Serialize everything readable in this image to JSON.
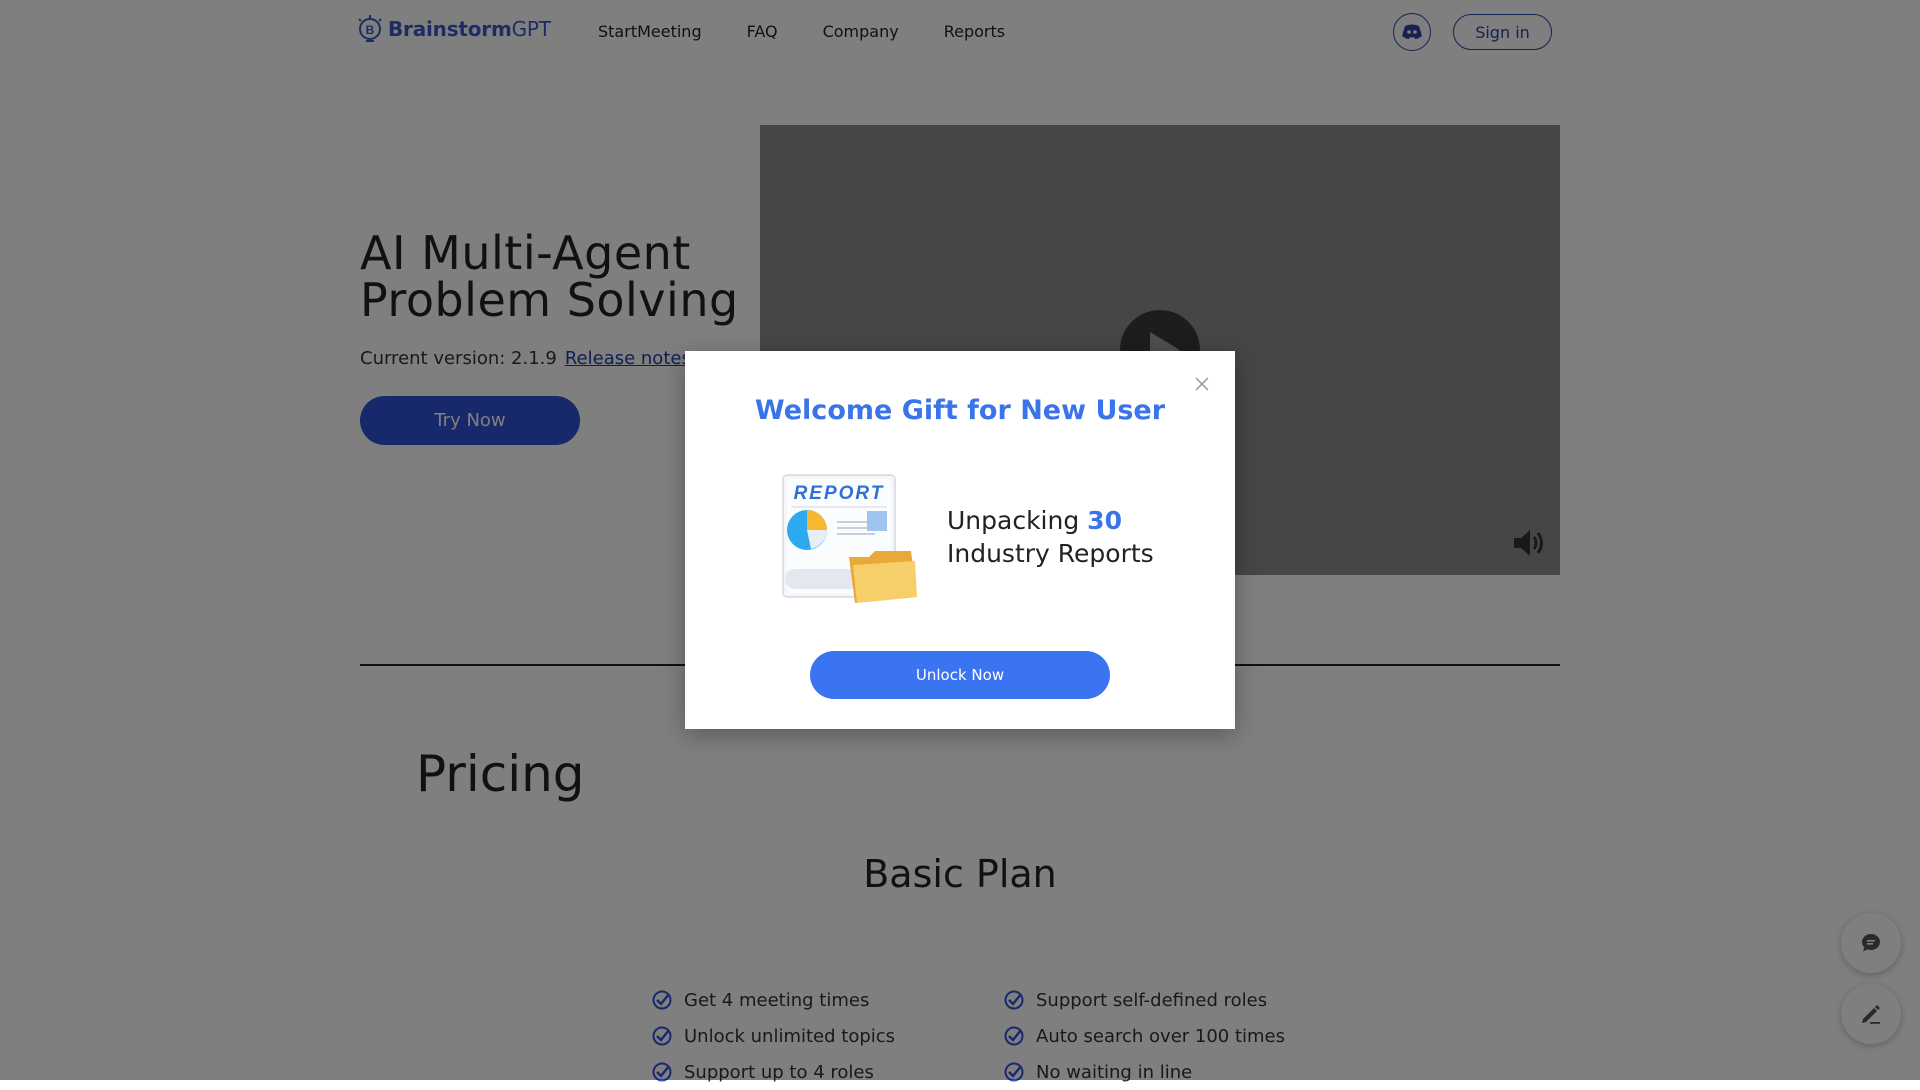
{
  "nav": {
    "logo": {
      "bold": "Brainstorm",
      "rest": "GPT"
    },
    "links": [
      "StartMeeting",
      "FAQ",
      "Company",
      "Reports"
    ],
    "sign_in": "Sign in"
  },
  "hero": {
    "title_line1": "AI Multi-Agent",
    "title_line2": "Problem Solving",
    "version_label": "Current version: 2.1.9",
    "release_notes": "Release notes",
    "try_now": "Try Now"
  },
  "pricing": {
    "title": "Pricing",
    "plan_name": "Basic Plan",
    "features_left": [
      "Get 4 meeting times",
      "Unlock unlimited topics",
      "Support up to 4 roles"
    ],
    "features_right": [
      "Support self-defined roles",
      "Auto search over 100 times",
      "No waiting in line"
    ]
  },
  "modal": {
    "title": "Welcome Gift for New User",
    "illustration_label": "REPORT",
    "text_prefix": "Unpacking",
    "count": "30",
    "text_line2": "Industry Reports",
    "unlock_button": "Unlock Now"
  },
  "colors": {
    "brand_blue": "#2f52d6",
    "modal_accent": "#3b74e8",
    "overlay": "rgba(0,0,0,0.5)"
  },
  "icons": {
    "discord": "discord-icon",
    "play": "play-icon",
    "volume": "volume-icon",
    "check": "check-icon",
    "chat": "chat-icon",
    "edit": "pencil-icon",
    "close": "close-icon"
  }
}
